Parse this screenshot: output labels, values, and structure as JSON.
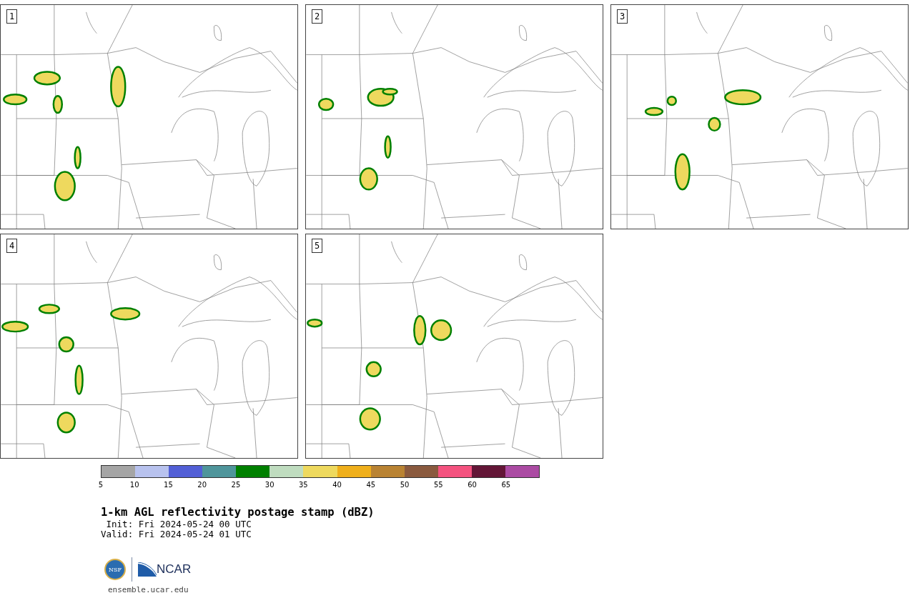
{
  "panels": [
    {
      "label": "1"
    },
    {
      "label": "2"
    },
    {
      "label": "3"
    },
    {
      "label": "4"
    },
    {
      "label": "5"
    }
  ],
  "colorbar": {
    "bins": [
      {
        "color": "#a5a5a5"
      },
      {
        "color": "#b8c2ee"
      },
      {
        "color": "#525fd6"
      },
      {
        "color": "#4f959b"
      },
      {
        "color": "#008000"
      },
      {
        "color": "#bfdcbf"
      },
      {
        "color": "#eed95e"
      },
      {
        "color": "#efaf1b"
      },
      {
        "color": "#b98333"
      },
      {
        "color": "#8a5a3f"
      },
      {
        "color": "#f4527f"
      },
      {
        "color": "#631637"
      },
      {
        "color": "#ab4ba3"
      }
    ],
    "ticks": [
      "5",
      "10",
      "15",
      "20",
      "25",
      "30",
      "35",
      "40",
      "45",
      "50",
      "55",
      "60",
      "65"
    ]
  },
  "title": "1-km AGL reflectivity postage stamp (dBZ)",
  "init": " Init: Fri 2024-05-24 00 UTC",
  "valid": "Valid: Fri 2024-05-24 01 UTC",
  "logos": {
    "nsf": "NSF",
    "ncar": "NCAR"
  },
  "footer_link": "ensemble.ucar.edu"
}
